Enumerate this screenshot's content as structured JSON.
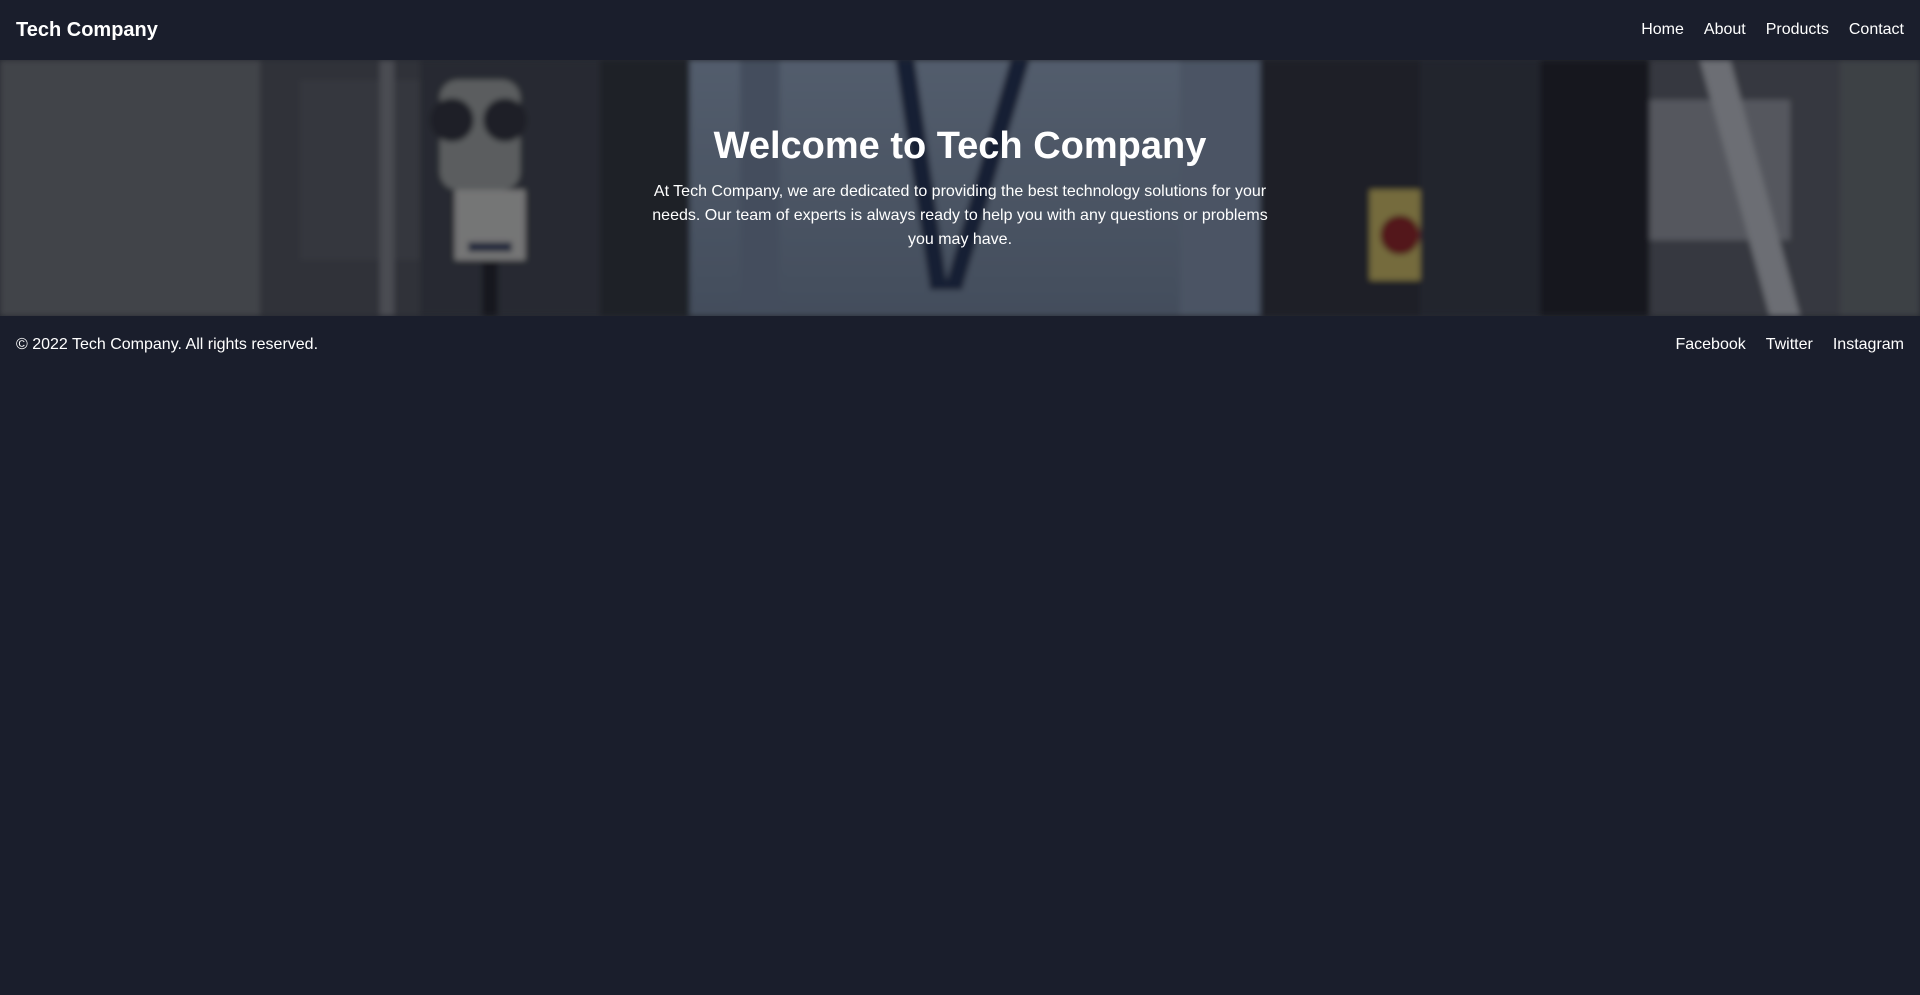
{
  "navbar": {
    "brand": "Tech Company",
    "links": [
      "Home",
      "About",
      "Products",
      "Contact"
    ]
  },
  "hero": {
    "title": "Welcome to Tech Company",
    "text": "At Tech Company, we are dedicated to providing the best technology solutions for your needs. Our team of experts is always ready to help you with any questions or problems you may have."
  },
  "footer": {
    "copyright": "© 2022 Tech Company. All rights reserved.",
    "links": [
      "Facebook",
      "Twitter",
      "Instagram"
    ]
  },
  "colors": {
    "background": "#1a1e2c",
    "text": "#ffffff"
  }
}
